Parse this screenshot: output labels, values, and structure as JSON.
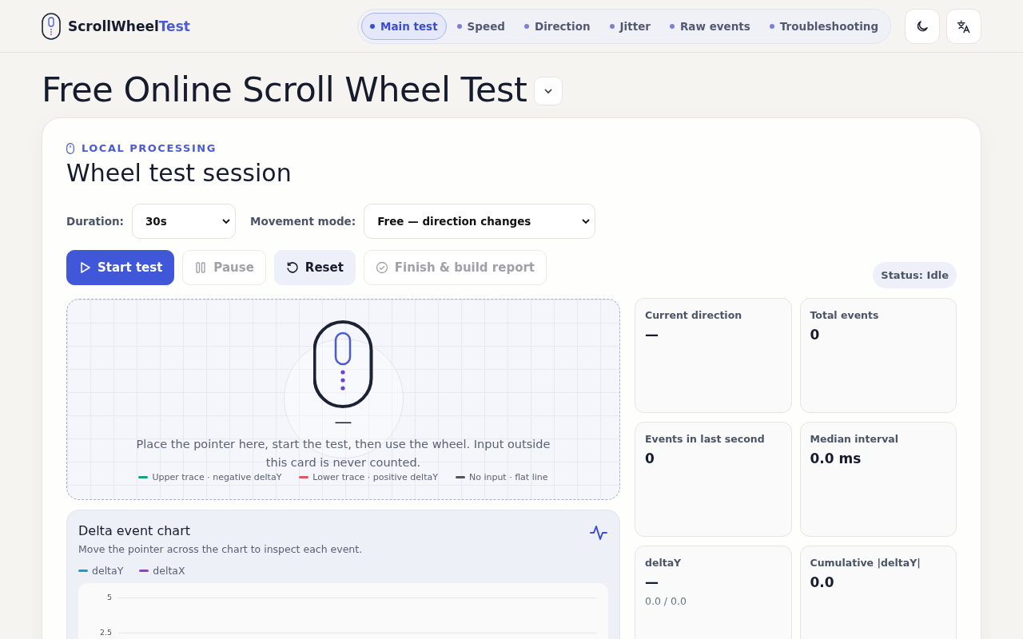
{
  "brand": {
    "name": "ScrollWheel",
    "accent": "Test"
  },
  "nav": [
    {
      "label": "Main test",
      "selected": true
    },
    {
      "label": "Speed",
      "selected": false
    },
    {
      "label": "Direction",
      "selected": false
    },
    {
      "label": "Jitter",
      "selected": false
    },
    {
      "label": "Raw events",
      "selected": false
    },
    {
      "label": "Troubleshooting",
      "selected": false
    }
  ],
  "page_title": "Free Online Scroll Wheel Test",
  "session": {
    "eyebrow": "LOCAL PROCESSING",
    "title": "Wheel test session",
    "duration": {
      "label": "Duration:",
      "value": "30s"
    },
    "mode": {
      "label": "Movement mode:",
      "value": "Free — direction changes"
    },
    "buttons": [
      {
        "label": "Start test",
        "kind": "primary",
        "disabled": false
      },
      {
        "label": "Pause",
        "kind": "pause",
        "disabled": true
      },
      {
        "label": "Reset",
        "kind": "reset",
        "disabled": false
      },
      {
        "label": "Finish & build report",
        "kind": "finish",
        "disabled": true
      }
    ],
    "status": "Status: Idle",
    "pad": {
      "reading": "—",
      "hint": "Place the pointer here, start the test, then use the wheel. Input outside this card is never counted.",
      "legend": [
        {
          "label": "Upper trace · negative deltaY",
          "color": "#10a37f"
        },
        {
          "label": "Lower trace · positive deltaY",
          "color": "#e05a5a"
        },
        {
          "label": "No input · flat line",
          "color": "#4b5563"
        }
      ]
    },
    "chart": {
      "title": "Delta event chart",
      "subtitle": "Move the pointer across the chart to inspect each event.",
      "legend": [
        {
          "label": "deltaY",
          "color": "#1a9bd7"
        },
        {
          "label": "deltaX",
          "color": "#8b3fd9"
        }
      ],
      "y_ticks": [
        "5",
        "2.5"
      ]
    },
    "stats": [
      {
        "label": "Current direction",
        "value": "—"
      },
      {
        "label": "Total events",
        "value": "0"
      },
      {
        "label": "Events in last second",
        "value": "0"
      },
      {
        "label": "Median interval",
        "value": "0.0 ms"
      },
      {
        "label": "deltaY",
        "value": "—",
        "sub": "0.0 / 0.0"
      },
      {
        "label": "Cumulative |deltaY|",
        "value": "0.0"
      }
    ]
  }
}
